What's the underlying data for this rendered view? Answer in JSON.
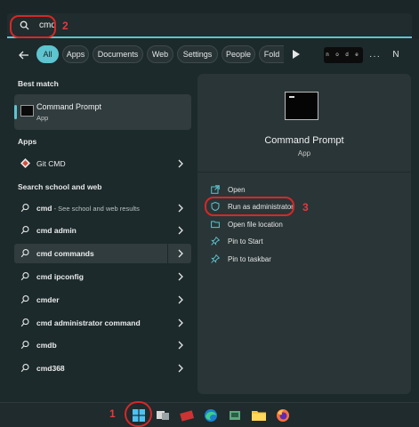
{
  "search": {
    "value": "cmd"
  },
  "annotations": {
    "step1": "1",
    "step2": "2",
    "step3": "3"
  },
  "filters": {
    "chips": [
      "All",
      "Apps",
      "Documents",
      "Web",
      "Settings",
      "People",
      "Fold"
    ],
    "active": "All",
    "promo_text": "n o d e",
    "avatar_letter": "N"
  },
  "left": {
    "best_match_title": "Best match",
    "best_match": {
      "name": "Command Prompt",
      "type": "App"
    },
    "apps_title": "Apps",
    "apps": [
      {
        "label": "Git CMD"
      }
    ],
    "web_title": "Search school and web",
    "web_results": [
      {
        "bold": "cmd",
        "rest": " - See school and web results"
      },
      {
        "bold": "cmd admin",
        "rest": ""
      },
      {
        "bold": "cmd commands",
        "rest": ""
      },
      {
        "bold": "cmd ipconfig",
        "rest": ""
      },
      {
        "bold": "cmder",
        "rest": ""
      },
      {
        "bold": "cmd administrator command",
        "rest": ""
      },
      {
        "bold": "cmdb",
        "rest": ""
      },
      {
        "bold": "cmd368",
        "rest": ""
      }
    ]
  },
  "right": {
    "app_name": "Command Prompt",
    "app_type": "App",
    "actions": [
      {
        "label": "Open",
        "icon": "open-icon"
      },
      {
        "label": "Run as administrator",
        "icon": "shield-icon"
      },
      {
        "label": "Open file location",
        "icon": "folder-icon"
      },
      {
        "label": "Pin to Start",
        "icon": "pin-icon"
      },
      {
        "label": "Pin to taskbar",
        "icon": "pin-icon"
      }
    ]
  },
  "colors": {
    "accent": "#5ec4cf",
    "annotation_red": "#d62828",
    "background": "#1c2a2c"
  }
}
